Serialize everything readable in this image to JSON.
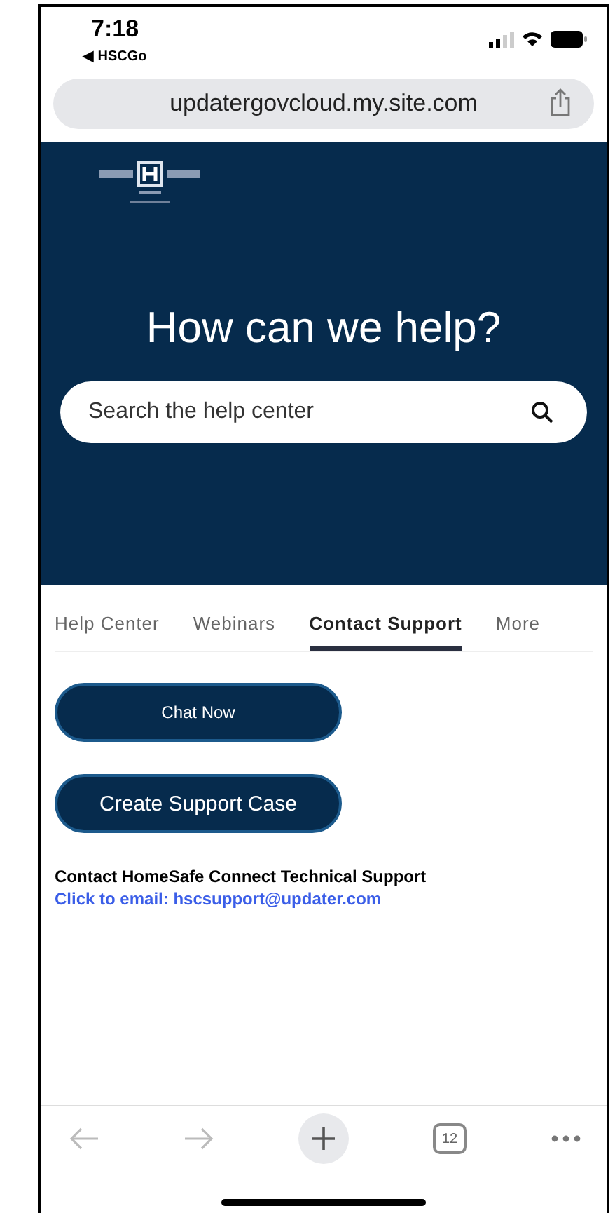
{
  "status_bar": {
    "time": "7:18",
    "back_app": "◀ HSCGo"
  },
  "browser": {
    "url": "updatergovcloud.my.site.com"
  },
  "hero": {
    "title": "How can we help?",
    "search": {
      "placeholder": "Search the help center"
    }
  },
  "tabs": [
    {
      "label": "Help Center",
      "selected": false
    },
    {
      "label": "Webinars",
      "selected": false
    },
    {
      "label": "Contact Support",
      "selected": true
    },
    {
      "label": "More",
      "selected": false
    }
  ],
  "buttons": [
    {
      "label": "Chat Now",
      "kind": "small"
    },
    {
      "label": "Create Support Case",
      "kind": "large"
    }
  ],
  "contact": {
    "heading": "Contact HomeSafe Connect Technical Support",
    "link": "Click to email: hscsupport@updater.com"
  },
  "toolbar": {
    "tab_count": "12"
  }
}
